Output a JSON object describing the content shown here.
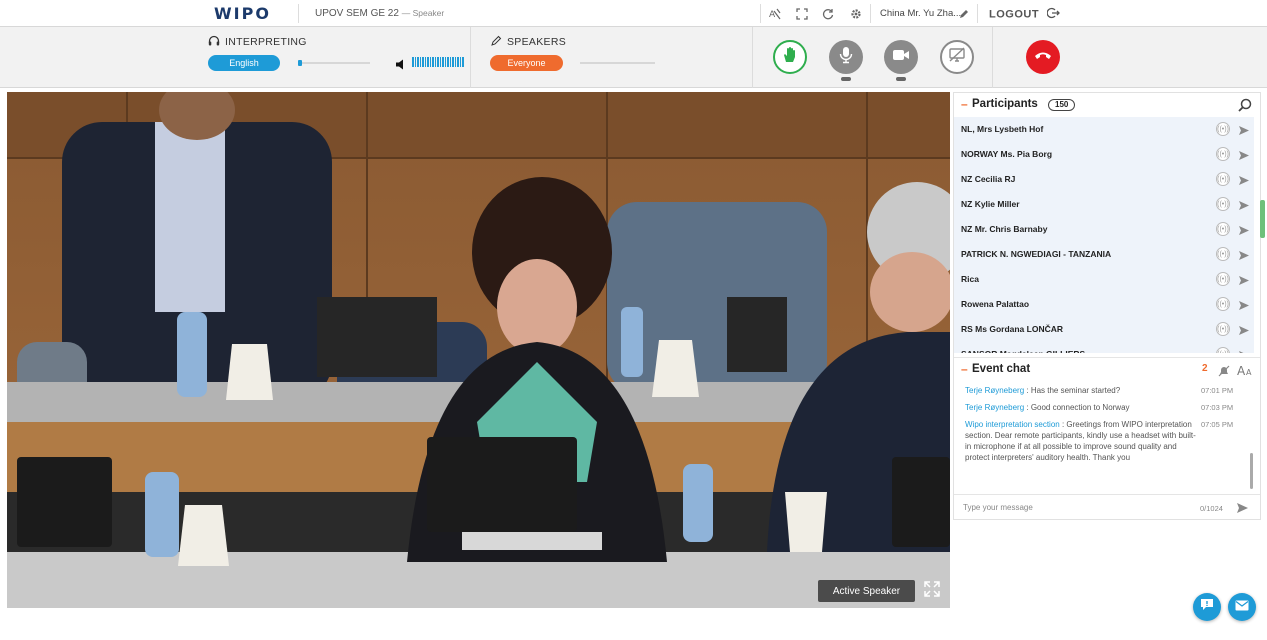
{
  "header": {
    "logo": "WIPO",
    "event_title": "UPOV SEM GE 22",
    "role": "— Speaker",
    "user_name": "China Mr. Yu Zha...",
    "logout": "LOGOUT"
  },
  "interpreting": {
    "label": "INTERPRETING",
    "language": "English"
  },
  "speakers": {
    "label": "SPEAKERS",
    "selection": "Everyone"
  },
  "video": {
    "active_speaker_label": "Active Speaker"
  },
  "participants": {
    "title": "Participants",
    "count": "150",
    "items": [
      "NL, Mrs Lysbeth Hof",
      "NORWAY Ms. Pia Borg",
      "NZ Cecilia RJ",
      "NZ Kylie Miller",
      "NZ Mr. Chris Barnaby",
      "PATRICK N. NGWEDIAGI - TANZANIA",
      "Rica",
      "Rowena Palattao",
      "RS Ms Gordana LONČAR",
      "SANSOR Magdaleen GILLIERS"
    ]
  },
  "chat": {
    "title": "Event chat",
    "unread": "2",
    "messages": [
      {
        "author": "Terje Røyneberg",
        "sep": " : ",
        "text": "Has the seminar started?",
        "time": "07:01 PM"
      },
      {
        "author": "Terje Røyneberg",
        "sep": " : ",
        "text": "Good connection to Norway",
        "time": "07:03 PM"
      },
      {
        "author": "Wipo interpretation section",
        "sep": " : ",
        "text": "Greetings from WIPO interpretation section. Dear remote participants, kindly use a headset with built-in microphone if at all possible to improve sound quality and protect interpreters' auditory health. Thank you",
        "time": "07:05 PM"
      }
    ],
    "placeholder": "Type your message",
    "char_count": "0/1024"
  }
}
